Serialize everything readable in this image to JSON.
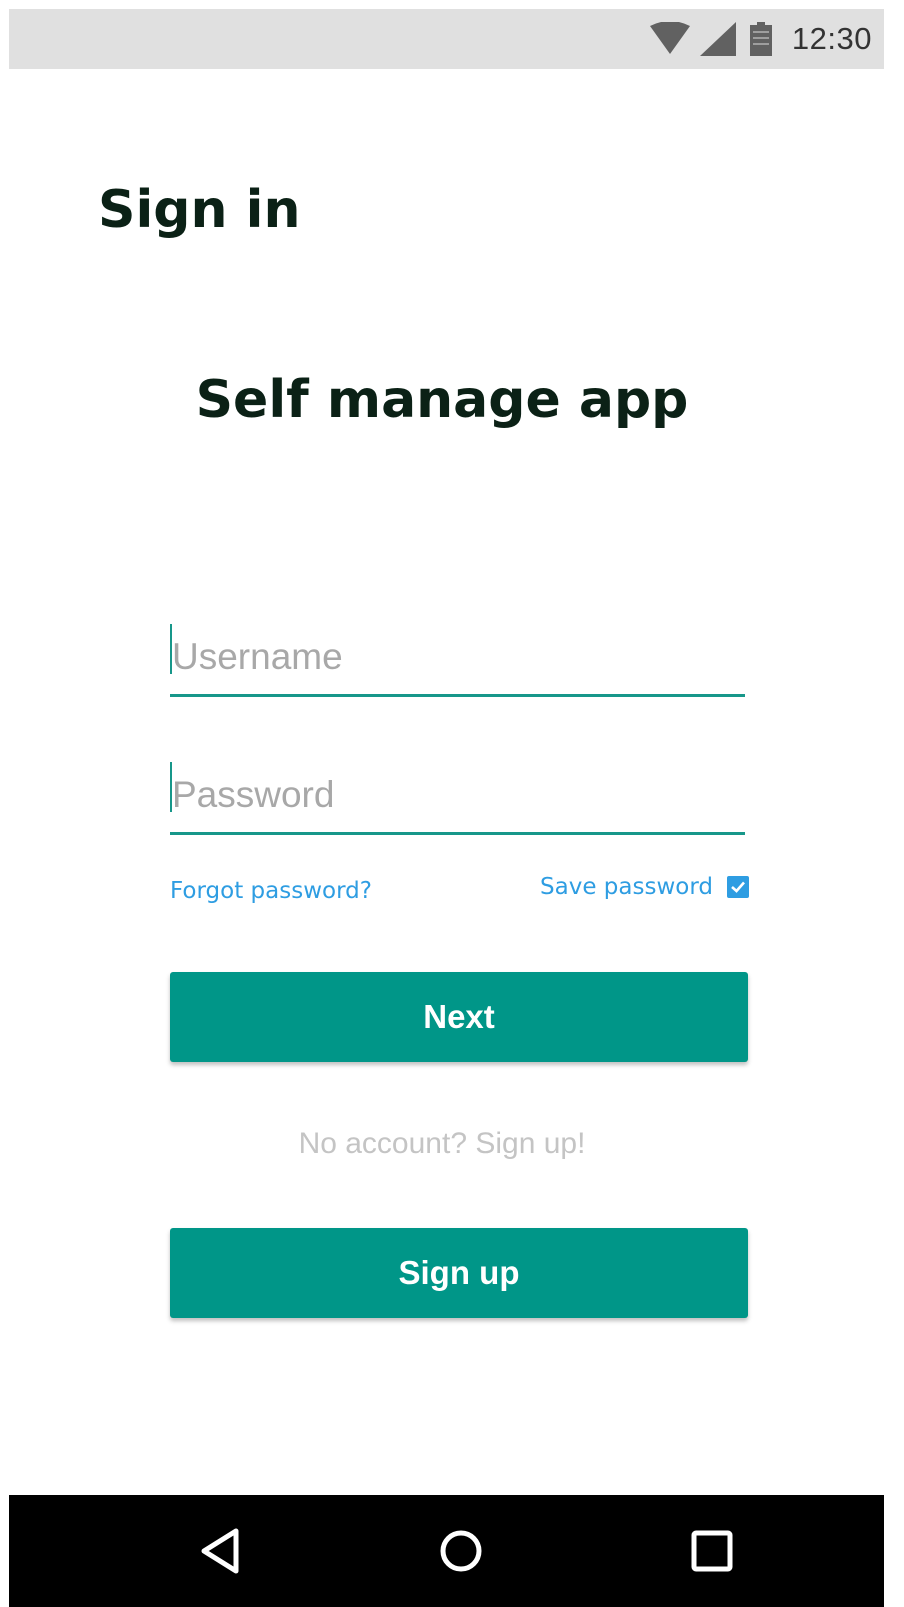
{
  "status_bar": {
    "time": "12:30",
    "icons": [
      "wifi-icon",
      "signal-icon",
      "battery-icon"
    ]
  },
  "header": {
    "title": "Sign in"
  },
  "app": {
    "name": "Self manage app"
  },
  "form": {
    "username_placeholder": "Username",
    "username_value": "",
    "password_placeholder": "Password",
    "password_value": "",
    "forgot_password_label": "Forgot password?",
    "save_password_label": "Save password",
    "save_password_checked": true,
    "next_label": "Next",
    "no_account_text": "No account? Sign up!",
    "signup_label": "Sign up"
  },
  "nav_bar": {
    "icons": [
      "back-icon",
      "home-icon",
      "recent-apps-icon"
    ]
  },
  "colors": {
    "accent": "#009688",
    "link": "#2e9de2",
    "title": "#0b2116",
    "status_bar_bg": "#e0e0e0",
    "nav_bar_bg": "#000000"
  }
}
